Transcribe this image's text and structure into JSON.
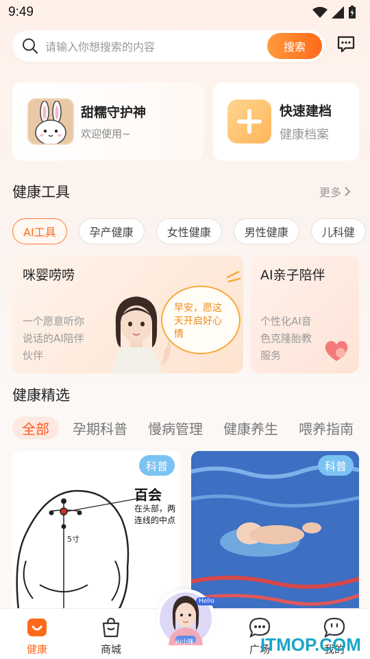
{
  "status": {
    "time": "9:49"
  },
  "search": {
    "placeholder": "请输入你想搜索的内容",
    "button": "搜索"
  },
  "cards": {
    "user": {
      "title": "甜糯守护神",
      "subtitle": "欢迎使用~"
    },
    "quick": {
      "title": "快速建档",
      "subtitle": "健康档案"
    }
  },
  "tools": {
    "title": "健康工具",
    "more": "更多",
    "chips": [
      "AI工具",
      "孕产健康",
      "女性健康",
      "男性健康",
      "儿科健"
    ],
    "ai_cards": [
      {
        "title": "咪婴唠唠",
        "desc_lines": [
          "一个愿意听你",
          "说话的AI陪伴",
          "伙伴"
        ],
        "bubble": "早安，愿这天开启好心情"
      },
      {
        "title": "AI亲子陪伴",
        "desc_lines": [
          "个性化AI音",
          "色克隆胎教",
          "服务"
        ]
      }
    ]
  },
  "featured": {
    "title": "健康精选",
    "tabs": [
      "全部",
      "孕期科普",
      "慢病管理",
      "健康养生",
      "喂养指南"
    ],
    "articles": [
      {
        "tag": "科普",
        "heading": "百会",
        "text_lines": [
          "在头部，两",
          "连线的中点"
        ],
        "measure": "5寸"
      },
      {
        "tag": "科普"
      }
    ]
  },
  "tabbar": {
    "items": [
      "健康",
      "商城",
      "广场",
      "我的"
    ],
    "center": {
      "badge": "Hello",
      "label": "AI小咪"
    }
  },
  "watermark": "ITMOP.COM",
  "colors": {
    "accent": "#ff6a1a",
    "tag": "#7ac3f2"
  }
}
